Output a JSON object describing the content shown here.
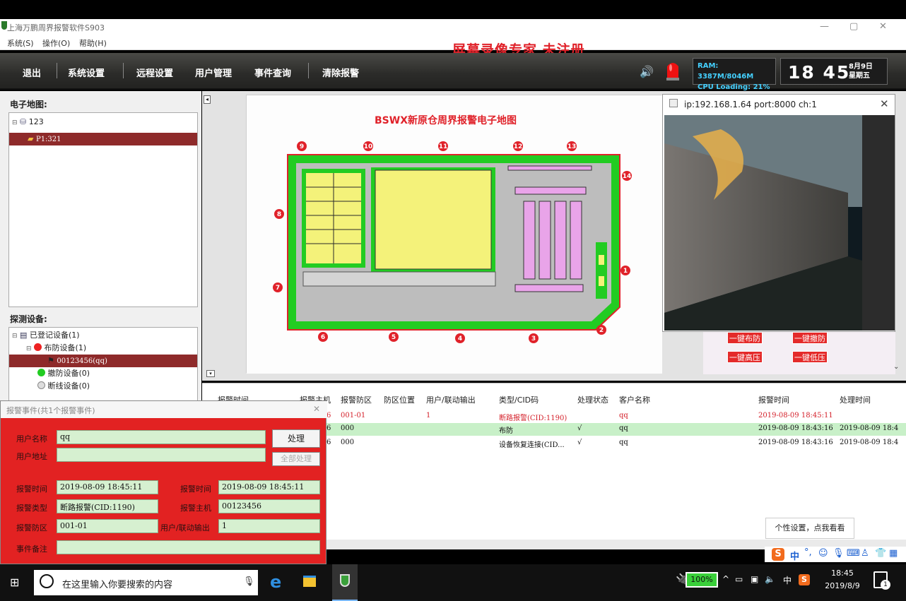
{
  "window": {
    "title": "上海万鹏周界报警软件S903",
    "minimize": "—",
    "restore": "▢",
    "close": "✕"
  },
  "menu": {
    "items": [
      "系统(S)",
      "操作(O)",
      "帮助(H)"
    ],
    "watermark": "屏幕录像专家 未注册"
  },
  "toolbar": {
    "exit": "退出",
    "system_settings": "系统设置",
    "remote_settings": "远程设置",
    "user_management": "用户管理",
    "event_query": "事件查询",
    "clear_alarm": "清除报警",
    "ram": "RAM: 3387M/8046M",
    "cpu": "CPU Loading: 21%",
    "time": "18 45",
    "date": "8月9日",
    "weekday": "星期五"
  },
  "left": {
    "map_header": "电子地图:",
    "map_tree": [
      "123",
      "P1:321"
    ],
    "device_header": "探测设备:",
    "device_tree": [
      "已登记设备(1)",
      "布防设备(1)",
      "00123456(qq)",
      "撤防设备(0)",
      "断线设备(0)"
    ]
  },
  "map": {
    "title": "BSWX新原仓周界报警电子地图",
    "zone_markers": [
      "1",
      "2",
      "3",
      "4",
      "5",
      "6",
      "7",
      "8",
      "9",
      "10",
      "11",
      "12",
      "13",
      "14"
    ]
  },
  "video": {
    "title": "ip:192.168.1.64 port:8000 ch:1",
    "close": "✕"
  },
  "quick": {
    "arm": "一键布防",
    "disarm": "一键撤防",
    "high_voltage": "一键高压",
    "low_voltage": "一键低压"
  },
  "event_table": {
    "headers": [
      "报警时间",
      "报警主机",
      "报警防区",
      "防区位置",
      "用户/联动输出",
      "类型/CID码",
      "处理状态",
      "客户名称",
      "报警时间",
      "处理时间"
    ],
    "rows": [
      {
        "host": "6",
        "zone": "001-01",
        "output": "1",
        "type": "断路报警(CID:1190)",
        "status": "",
        "customer": "qq",
        "alarm_time": "2019-08-09 18:45:11",
        "handle_time": ""
      },
      {
        "host": "6",
        "zone": "000",
        "output": "",
        "type": "布防",
        "status": "√",
        "customer": "qq",
        "alarm_time": "2019-08-09 18:43:16",
        "handle_time": "2019-08-09 18:4"
      },
      {
        "host": "6",
        "zone": "000",
        "output": "",
        "type": "设备恢复连接(CID...",
        "status": "√",
        "customer": "qq",
        "alarm_time": "2019-08-09 18:43:16",
        "handle_time": "2019-08-09 18:4"
      }
    ]
  },
  "dialog": {
    "title": "报警事件(共1个报警事件)",
    "close": "✕",
    "user_name_label": "用户名称",
    "user_name": "qq",
    "user_address_label": "用户地址",
    "user_address": "",
    "handle_button": "处理",
    "handle_all_button": "全部处理",
    "alarm_time_label": "报警时间",
    "alarm_time": "2019-08-09 18:45:11",
    "alarm_time2_label": "报警时间",
    "alarm_time2": "2019-08-09 18:45:11",
    "alarm_type_label": "报警类型",
    "alarm_type": "断路报警(CID:1190)",
    "alarm_host_label": "报警主机",
    "alarm_host": "00123456",
    "alarm_zone_label": "报警防区",
    "alarm_zone": "001-01",
    "output_label": "用户/联动输出",
    "output": "1",
    "note_label": "事件备注",
    "note": ""
  },
  "tooltip": "个性设置，点我看看",
  "taskbar": {
    "search_placeholder": "在这里输入你要搜索的内容",
    "battery": "100%",
    "ime": "中",
    "time": "18:45",
    "date": "2019/8/9",
    "notification_count": "1"
  },
  "colors": {
    "alarm_red": "#e22222",
    "field_green": "#d6f0d0",
    "map_red": "#e0222a",
    "map_green": "#22cc22",
    "map_yellow": "#f4f27a"
  }
}
